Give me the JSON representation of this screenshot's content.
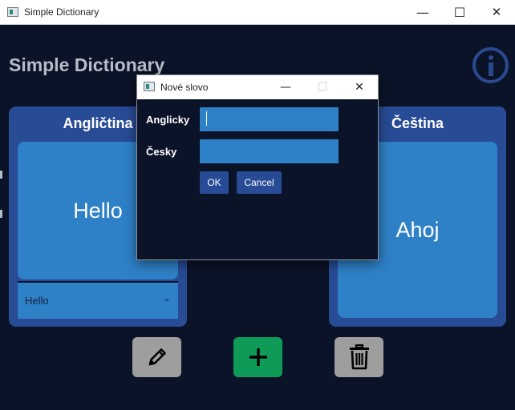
{
  "window": {
    "title": "Simple Dictionary",
    "minimize_glyph": "—",
    "maximize_glyph": "☐",
    "close_glyph": "✕"
  },
  "heading": "Simple Dictionary",
  "left_panel": {
    "title": "Angličtina",
    "word": "Hello",
    "select_value": "Hello",
    "chevron_glyph": "⌄"
  },
  "right_panel": {
    "title": "Čeština",
    "word": "Ahoj"
  },
  "actions": {
    "edit_icon": "pencil-icon",
    "add_icon": "plus-icon",
    "delete_icon": "trash-icon"
  },
  "dialog": {
    "title": "Nové slovo",
    "english_label": "Anglicky",
    "english_value": "",
    "czech_label": "Česky",
    "czech_value": "",
    "ok_label": "OK",
    "cancel_label": "Cancel",
    "minimize_glyph": "—",
    "maximize_glyph": "☐",
    "close_glyph": "✕"
  },
  "colors": {
    "background": "#0b1328",
    "panel": "#274b95",
    "card": "#2e80c7",
    "add_button": "#0f9b57",
    "neutral_button": "#9e9e9e",
    "heading_text": "#b7bdc8"
  }
}
